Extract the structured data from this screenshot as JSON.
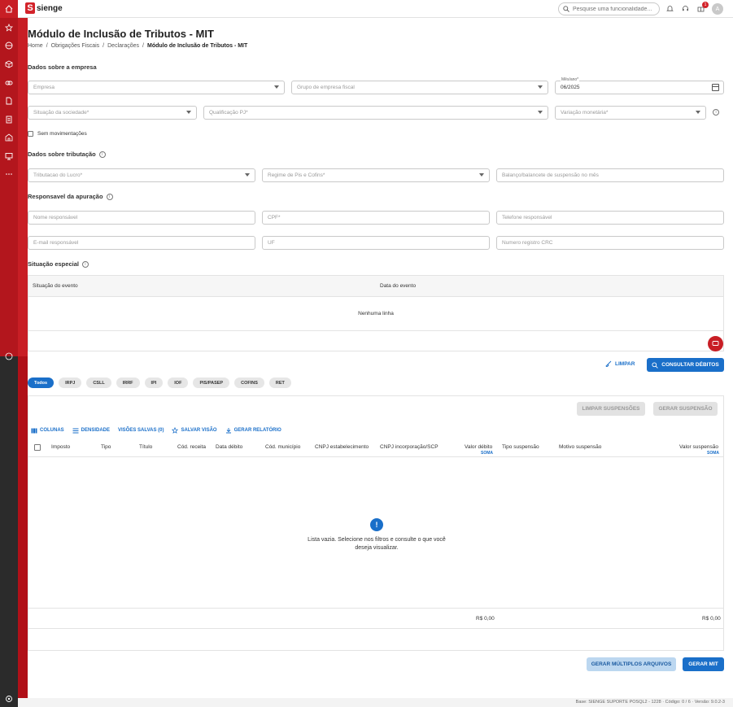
{
  "app": {
    "logo_text": "sienge",
    "logo_letter": "S",
    "search_placeholder": "Pesquise uma funcionalidade...",
    "notifications_count": "1",
    "avatar_initial": "A"
  },
  "page": {
    "title": "Módulo de Inclusão de Tributos - MIT",
    "breadcrumb": [
      "Home",
      "Obrigações Fiscais",
      "Declarações",
      "Módulo de Inclusão de Tributos - MIT"
    ]
  },
  "empresa": {
    "section_title": "Dados sobre a empresa",
    "empresa_placeholder": "Empresa",
    "grupo_placeholder": "Grupo de empresa fiscal",
    "mes_label": "Mês/ano*",
    "mes_value": "06/2025",
    "situacao_placeholder": "Situação da sociedade*",
    "qualificacao_placeholder": "Qualificação PJ*",
    "variacao_placeholder": "Variação monetária*",
    "sem_movimentacoes": "Sem movimentações"
  },
  "tributacao": {
    "section_title": "Dados sobre tributação",
    "tributacao_placeholder": "Tributacao do Lucro*",
    "regime_placeholder": "Regime de Pis e Cofins*",
    "balanco_placeholder": "Balanço/balancete de suspensão no mês"
  },
  "responsavel": {
    "section_title": "Responsavel da apuração",
    "nome_placeholder": "Nome responsável",
    "cpf_placeholder": "CPF*",
    "telefone_placeholder": "Telefone responsável",
    "email_placeholder": "E-mail responsável",
    "uf_placeholder": "UF",
    "crc_placeholder": "Numero registro CRC"
  },
  "situacao_especial": {
    "section_title": "Situação especial",
    "columns": [
      "Situação do evento",
      "Data do evento"
    ],
    "empty_text": "Nenhuma linha"
  },
  "actions": {
    "limpar": "LIMPAR",
    "consultar": "CONSULTAR DÉBITOS",
    "limpar_suspensoes": "LIMPAR SUSPENSÕES",
    "gerar_suspensao": "GERAR SUSPENSÃO",
    "gerar_multiplos": "GERAR MÚLTIPLOS ARQUIVOS",
    "gerar_mit": "GERAR MIT"
  },
  "chips": [
    "Todos",
    "IRPJ",
    "CSLL",
    "IRRF",
    "IPI",
    "IOF",
    "PIS/PASEP",
    "COFINS",
    "RET"
  ],
  "toolbar": {
    "colunas": "COLUNAS",
    "densidade": "DENSIDADE",
    "visoes": "VISÕES SALVAS (0)",
    "salvar": "SALVAR VISÃO",
    "relatorio": "GERAR RELATÓRIO"
  },
  "grid": {
    "columns": [
      "Imposto",
      "Tipo",
      "Título",
      "Cód. receita",
      "Data débito",
      "Cód. município",
      "CNPJ estabelecimento",
      "CNPJ incorporação/SCP",
      "Valor débito",
      "Tipo suspensão",
      "Motivo suspensão",
      "Valor suspensão"
    ],
    "soma_label": "SOMA",
    "empty_message": "Lista vazia. Selecione nos filtros e consulte o que você deseja visualizar.",
    "total_debito": "R$ 0,00",
    "total_suspensao": "R$ 0,00"
  },
  "footer": "Base: SIENGE SUPORTE POSQL2 - 1228 · Código: 0 / 6 · Versão: 9.0.2-3"
}
